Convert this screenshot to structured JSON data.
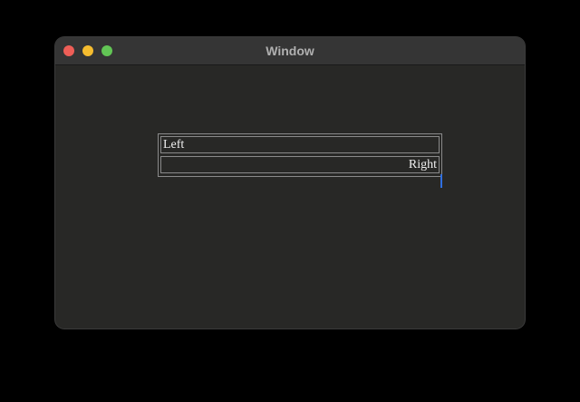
{
  "window": {
    "title": "Window",
    "controls": {
      "close_color": "#ee5e57",
      "minimize_color": "#f5bc2f",
      "zoom_color": "#62c555"
    }
  },
  "table": {
    "rows": [
      {
        "text": "Left",
        "align": "left"
      },
      {
        "text": "Right",
        "align": "right"
      }
    ]
  },
  "cursor": {
    "type": "text-caret",
    "color": "#2f6fe0"
  }
}
